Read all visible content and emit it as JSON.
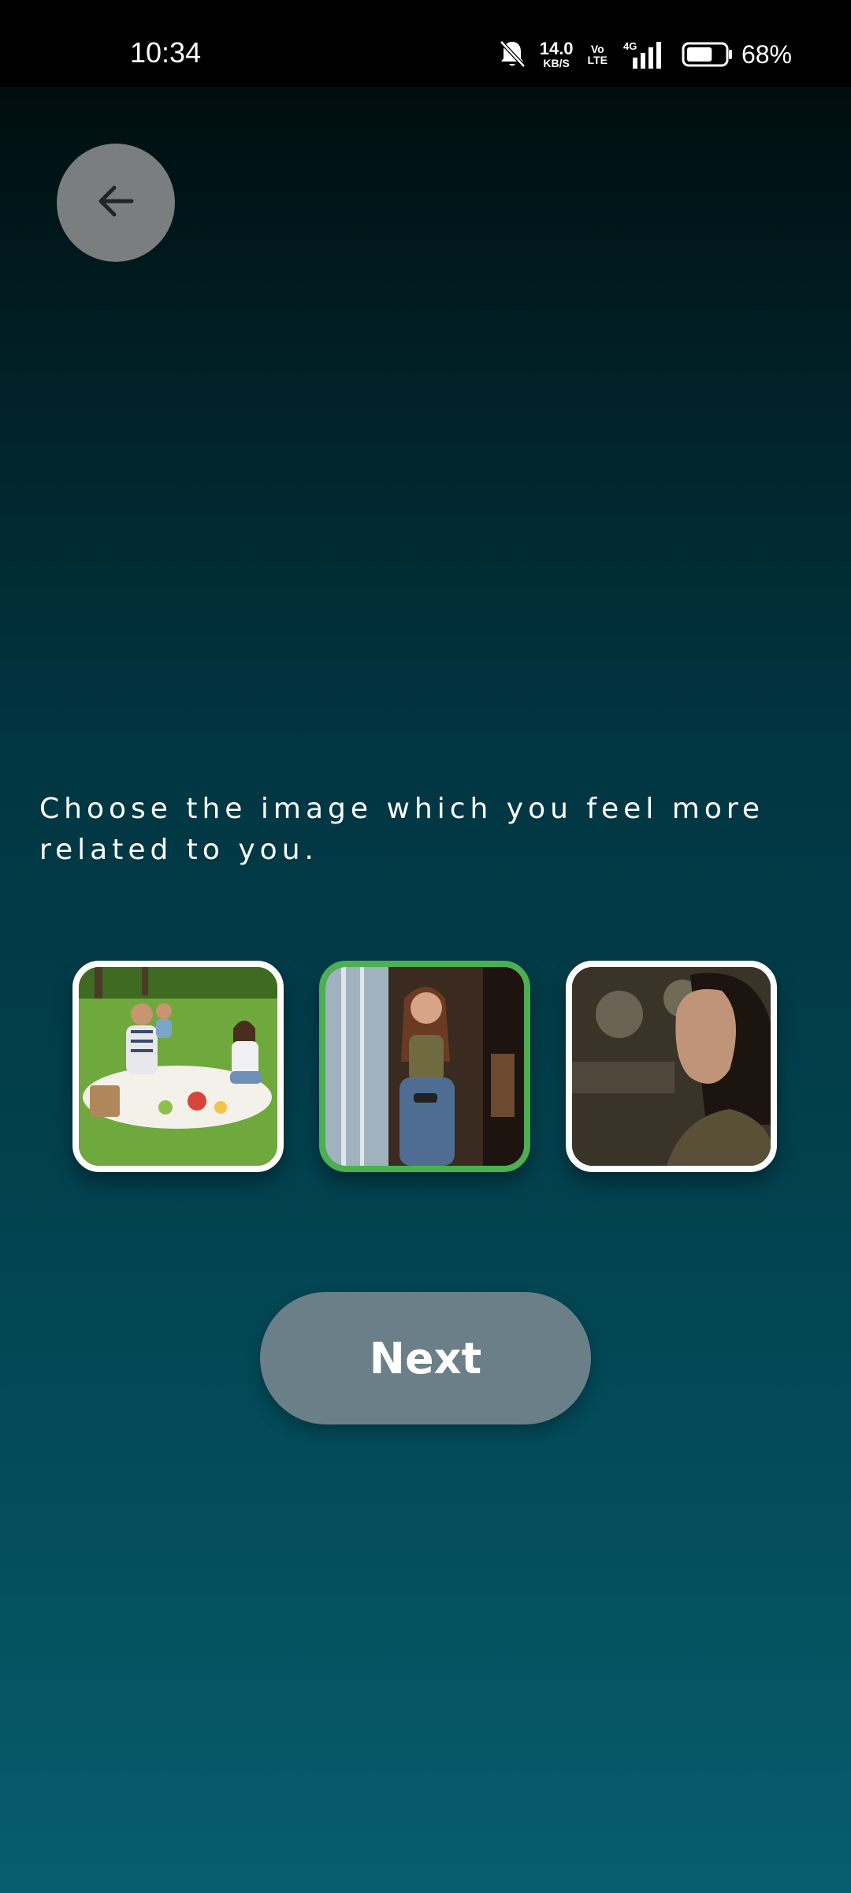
{
  "status_bar": {
    "time": "10:34",
    "net_speed_value": "14.0",
    "net_speed_unit": "KB/S",
    "volte_top": "Vo",
    "volte_bottom": "LTE",
    "network_type": "4G",
    "battery_percent": "68%",
    "battery_level": 0.68,
    "icons": [
      "bell-muted-icon",
      "signal-icon",
      "battery-icon"
    ]
  },
  "header": {
    "back_icon": "arrow-left-icon"
  },
  "prompt": {
    "text": "Choose the image which you feel more related to you."
  },
  "choices": [
    {
      "id": "picnic-family",
      "selected": false
    },
    {
      "id": "woman-thinking",
      "selected": true
    },
    {
      "id": "woman-worried",
      "selected": false
    }
  ],
  "next_button": {
    "label": "Next"
  },
  "colors": {
    "selected_border": "#4caf50",
    "unselected_border": "#ffffff",
    "button_bg": "#6b7f88",
    "back_button_bg": "#7a7e80"
  }
}
